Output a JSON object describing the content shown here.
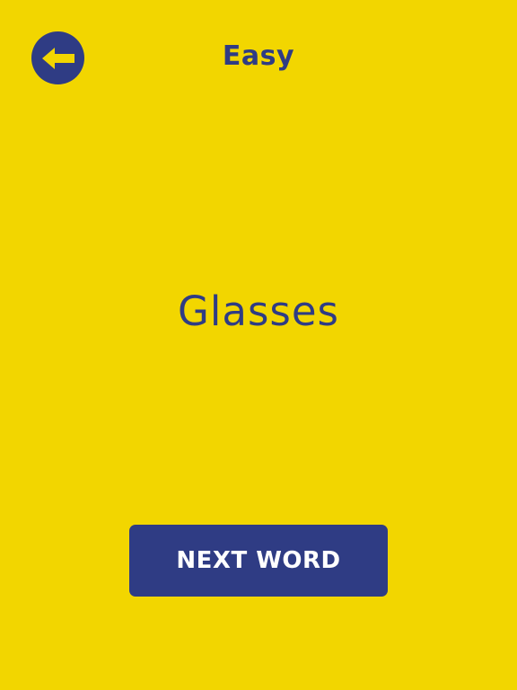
{
  "header": {
    "title": "Easy",
    "back_icon": "arrow-left-icon"
  },
  "main": {
    "word": "Glasses"
  },
  "footer": {
    "next_label": "NEXT WORD"
  },
  "colors": {
    "background": "#F2D600",
    "primary": "#2F3C84",
    "on_primary": "#FFFFFF"
  }
}
